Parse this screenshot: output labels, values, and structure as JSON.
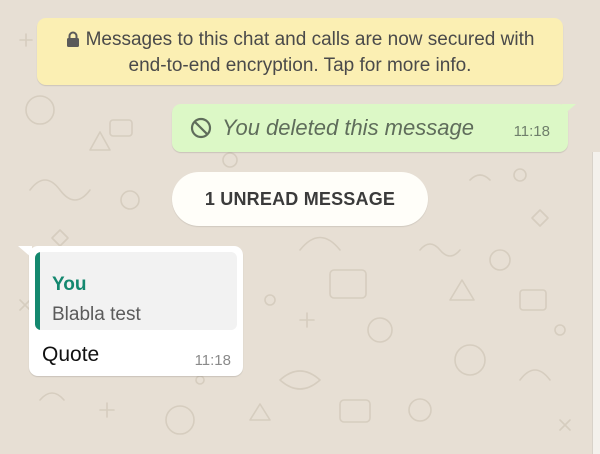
{
  "banner": {
    "line1": "Messages to this chat and calls are now secured with",
    "line2": "end-to-end encryption. Tap for more info.",
    "icon": "lock-icon"
  },
  "outgoing": {
    "text": "You deleted this message",
    "time": "11:18",
    "icon": "ban-icon",
    "bubble_color": "#dcf8c6"
  },
  "divider": {
    "label": "1 UNREAD MESSAGE"
  },
  "incoming": {
    "quote_author": "You",
    "quote_text": "Blabla test",
    "message": "Quote",
    "time": "11:18",
    "quote_accent": "#14886f"
  }
}
